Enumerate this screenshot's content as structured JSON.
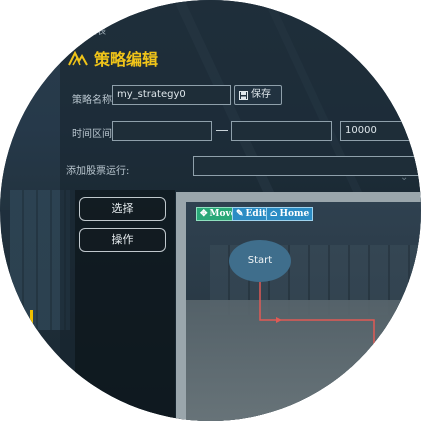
{
  "breadcrumb": "列表",
  "page_title": "策略编辑",
  "form": {
    "strategy_name_label": "策略名称",
    "strategy_name_value": "my_strategy0",
    "save_label": "保存",
    "time_range_label": "时间区间",
    "start_value": "",
    "end_value": "",
    "amount_value": "10000",
    "add_stock_label": "添加股票运行:",
    "add_stock_value": ""
  },
  "side_buttons": {
    "select_label": "选择",
    "operate_label": "操作"
  },
  "toolbar": {
    "move_label": "Move",
    "edit_label": "Edit",
    "home_label": "Home"
  },
  "flow": {
    "start_label": "Start"
  },
  "colors": {
    "accent": "#f0c419",
    "node": "#3f6e8c",
    "edge": "#e05a55",
    "tool_blue": "#2b8cc4",
    "tool_green": "#2aa878"
  },
  "icons": [
    "logo-icon",
    "save-icon",
    "move-icon",
    "edit-icon",
    "home-icon",
    "chevron-down-icon"
  ]
}
